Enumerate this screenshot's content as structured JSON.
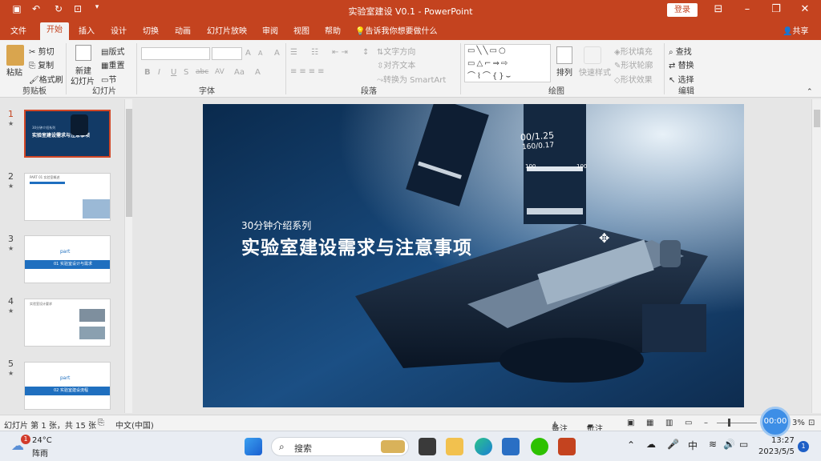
{
  "titlebar": {
    "title": "实验室建设 V0.1  -  PowerPoint",
    "login": "登录",
    "save_icon": "save-icon",
    "undo_icon": "undo-icon",
    "redo_icon": "redo-icon",
    "present_icon": "present-icon",
    "more_icon": "more-icon"
  },
  "tabs": [
    "文件",
    "开始",
    "插入",
    "设计",
    "切换",
    "动画",
    "幻灯片放映",
    "审阅",
    "视图",
    "帮助"
  ],
  "active_tab": "开始",
  "tell_me": "告诉我你想要做什么",
  "share": "共享",
  "ribbon": {
    "clipboard": {
      "paste": "粘贴",
      "cut": "剪切",
      "copy": "复制",
      "format_painter": "格式刷",
      "group": "剪贴板"
    },
    "slides": {
      "new_slide": "新建",
      "new_slide2": "幻灯片",
      "layout": "版式",
      "reset": "重置",
      "section": "节",
      "group": "幻灯片"
    },
    "font": {
      "group": "字体",
      "bold": "B",
      "italic": "I",
      "underline": "U",
      "shadow": "S",
      "strike": "abc",
      "spacing": "AV",
      "case": "Aa",
      "grow": "A",
      "shrink": "A",
      "clear": "A",
      "color": "A"
    },
    "paragraph": {
      "direction": "文字方向",
      "align": "对齐文本",
      "smartart": "转换为 SmartArt",
      "group": "段落"
    },
    "drawing": {
      "arrange": "排列",
      "quick_styles": "快速样式",
      "fill": "形状填充",
      "outline": "形状轮廓",
      "effects": "形状效果",
      "group": "绘图"
    },
    "editing": {
      "find": "查找",
      "replace": "替换",
      "select": "选择",
      "group": "编辑"
    }
  },
  "thumbnails": [
    {
      "num": "1",
      "title": "实验室建设需求与注意事项",
      "subtitle": "30分钟介绍系列"
    },
    {
      "num": "2",
      "title": "PART 01 实验室概述"
    },
    {
      "num": "3",
      "part": "part",
      "label": "01 实验室设计与需求"
    },
    {
      "num": "4",
      "title": "实验室设计要求"
    },
    {
      "num": "5",
      "part": "part",
      "label": "02 实验室建设流程"
    }
  ],
  "slide": {
    "kicker": "30分钟介绍系列",
    "title": "实验室建设需求与注意事项",
    "objective_top": "00/1.25",
    "objective_bottom": "160/0.17",
    "mark_left": "100",
    "mark_right": "100"
  },
  "status": {
    "slide_info": "幻灯片 第 1 张，共 15 张",
    "language": "中文(中国)",
    "notes": "备注",
    "comments": "批注",
    "zoom": "3%"
  },
  "timer": "00:00",
  "taskbar": {
    "temp": "24°C",
    "weather": "阵雨",
    "search": "搜索",
    "ime": "中",
    "time": "13:27",
    "date": "2023/5/5",
    "notify": "1",
    "weather_badge": "1"
  },
  "colors": {
    "accent": "#c4431f",
    "slide_blue": "#1f6fbf"
  }
}
